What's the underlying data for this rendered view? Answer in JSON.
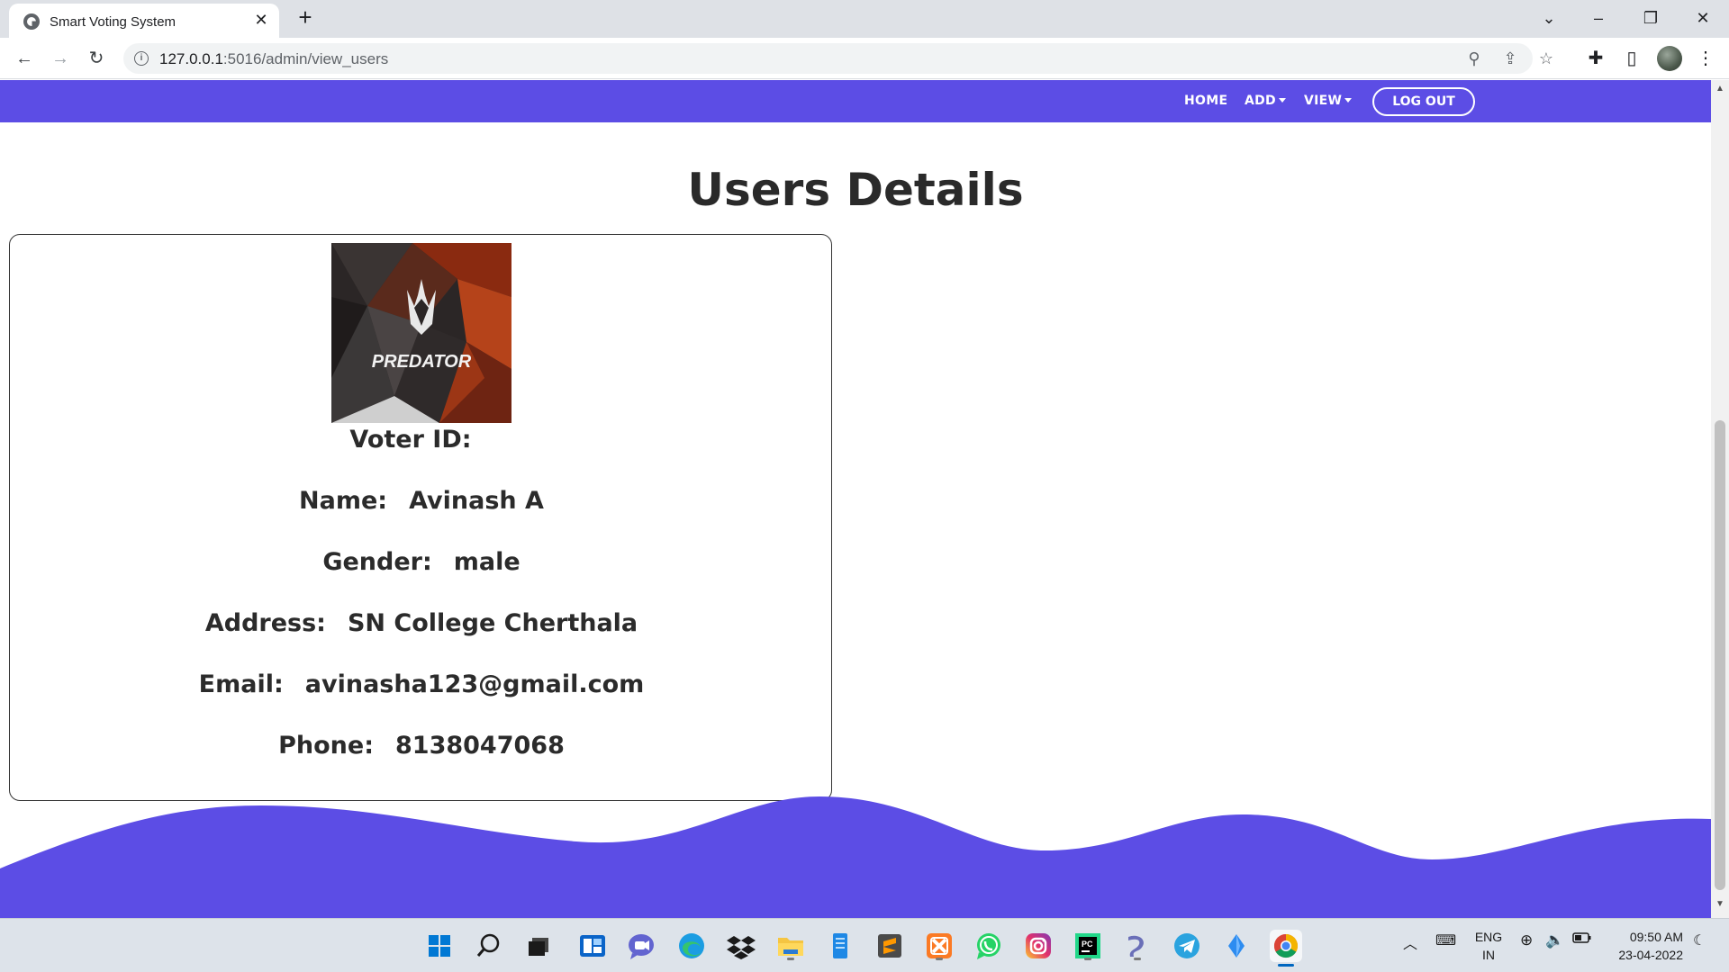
{
  "browser": {
    "tab_title": "Smart Voting System",
    "url_host": "127.0.0.1",
    "url_path": ":5016/admin/view_users",
    "close_glyph": "✕",
    "newtab_glyph": "+"
  },
  "navbar": {
    "brand_color": "#5c4de5",
    "links": {
      "home": "HOME",
      "add": "ADD",
      "view": "VIEW"
    },
    "logout_label": "LOG OUT"
  },
  "page": {
    "heading": "Users Details"
  },
  "user_card": {
    "avatar_text": "PREDATOR",
    "voter_id_label": "Voter ID:",
    "voter_id_value": "",
    "name_label": "Name:",
    "name_value": "Avinash A",
    "gender_label": "Gender:",
    "gender_value": "male",
    "address_label": "Address:",
    "address_value": "SN College Cherthala",
    "email_label": "Email:",
    "email_value": "avinasha123@gmail.com",
    "phone_label": "Phone:",
    "phone_value": "8138047068"
  },
  "taskbar": {
    "apps": [
      "windows-start",
      "search",
      "task-view",
      "widgets",
      "teams-chat",
      "edge",
      "dropbox",
      "file-explorer",
      "notepad",
      "sublime-text",
      "xampp",
      "whatsapp",
      "instagram",
      "pycharm",
      "stack-builder",
      "telegram",
      "kite",
      "chrome"
    ],
    "lang_line1": "ENG",
    "lang_line2": "IN",
    "time": "09:50 AM",
    "date": "23-04-2022"
  }
}
